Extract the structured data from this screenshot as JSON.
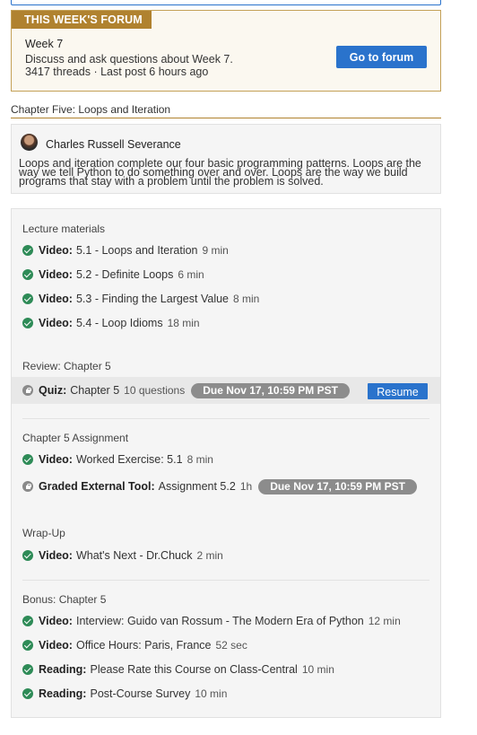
{
  "forum": {
    "badge": "THIS WEEK'S FORUM",
    "week": "Week 7",
    "description": "Discuss and ask questions about Week 7.",
    "stats": "3417 threads · Last post 6 hours ago",
    "button_label": "Go to forum"
  },
  "chapter": {
    "title": "Chapter Five: Loops and Iteration"
  },
  "instructor": {
    "name": "Charles Russell Severance",
    "description": "Loops and iteration complete our four basic programming patterns. Loops are the way we tell Python to do something over and over. Loops are the way we build programs that stay with a problem until the problem is solved."
  },
  "sections": [
    {
      "title": "Lecture materials",
      "items": [
        {
          "type": "Video:",
          "title": "5.1 - Loops and Iteration",
          "meta": "9 min",
          "status": "completed",
          "icon": "check-circle-icon"
        },
        {
          "type": "Video:",
          "title": "5.2 - Definite Loops",
          "meta": "6 min",
          "status": "completed",
          "icon": "check-circle-icon"
        },
        {
          "type": "Video:",
          "title": "5.3 - Finding the Largest Value",
          "meta": "8 min",
          "status": "completed",
          "icon": "check-circle-icon"
        },
        {
          "type": "Video:",
          "title": "5.4 - Loop Idioms",
          "meta": "18 min",
          "status": "completed",
          "icon": "check-circle-icon"
        }
      ]
    },
    {
      "title": "Review: Chapter 5",
      "items": [
        {
          "type": "Quiz:",
          "title": "Chapter 5",
          "meta": "10 questions",
          "due": "Due Nov 17, 10:59 PM PST",
          "action": "Resume",
          "status": "locked",
          "icon": "lock-icon"
        }
      ]
    },
    {
      "title": "Chapter 5 Assignment",
      "items": [
        {
          "type": "Video:",
          "title": "Worked Exercise: 5.1",
          "meta": "8 min",
          "status": "completed",
          "icon": "check-circle-icon"
        },
        {
          "type": "Graded External Tool:",
          "title": "Assignment 5.2",
          "meta": "1h",
          "due": "Due Nov 17, 10:59 PM PST",
          "status": "locked",
          "icon": "lock-icon"
        }
      ]
    },
    {
      "title": "Wrap-Up",
      "items": [
        {
          "type": "Video:",
          "title": "What's Next - Dr.Chuck",
          "meta": "2 min",
          "status": "completed",
          "icon": "check-circle-icon"
        }
      ]
    },
    {
      "title": "Bonus: Chapter 5",
      "items": [
        {
          "type": "Video:",
          "title": "Interview: Guido van Rossum - The Modern Era of Python",
          "meta": "12 min",
          "status": "completed",
          "icon": "check-circle-icon"
        },
        {
          "type": "Video:",
          "title": "Office Hours: Paris, France",
          "meta": "52 sec",
          "status": "completed",
          "icon": "check-circle-icon"
        },
        {
          "type": "Reading:",
          "title": "Please Rate this Course on Class-Central",
          "meta": "10 min",
          "status": "completed",
          "icon": "check-circle-icon"
        },
        {
          "type": "Reading:",
          "title": "Post-Course Survey",
          "meta": "10 min",
          "status": "completed",
          "icon": "check-circle-icon"
        }
      ]
    }
  ],
  "colors": {
    "accent": "#2a73cc",
    "forum_badge": "#b0822f",
    "completed": "#2e8b57",
    "locked": "#8a8a8a",
    "due_pill": "#8c8c8c"
  }
}
